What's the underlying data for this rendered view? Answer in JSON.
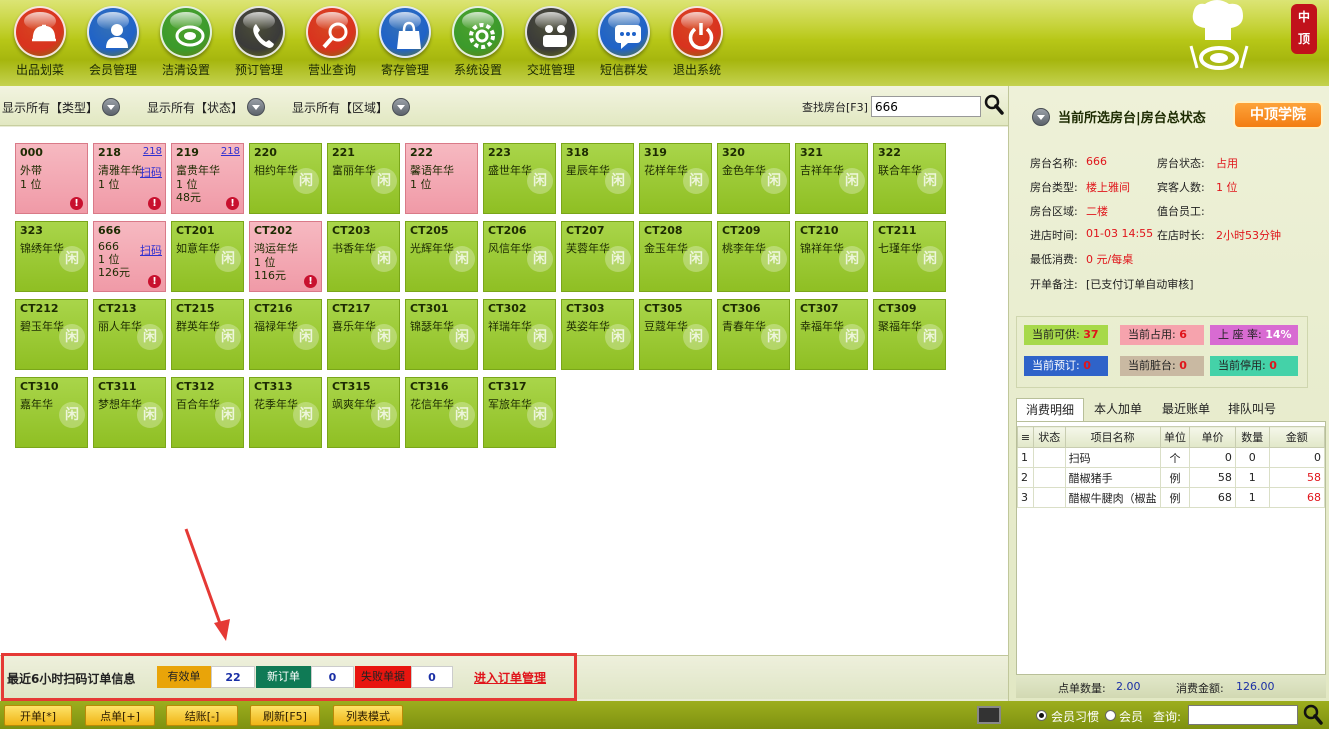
{
  "toolbar": [
    {
      "id": "dish-out",
      "label": "出品划菜",
      "color": "#d9321f",
      "icon": "cloche-icon"
    },
    {
      "id": "member",
      "label": "会员管理",
      "color": "#1f62c9",
      "icon": "person-icon"
    },
    {
      "id": "clean",
      "label": "洁清设置",
      "color": "#3b9a2c",
      "icon": "plate-icon"
    },
    {
      "id": "booking",
      "label": "预订管理",
      "color": "#3a3a3a",
      "icon": "phone-icon"
    },
    {
      "id": "business",
      "label": "营业查询",
      "color": "#d9321f",
      "icon": "magnifier-icon"
    },
    {
      "id": "storage",
      "label": "寄存管理",
      "color": "#1f62c9",
      "icon": "bag-icon"
    },
    {
      "id": "settings",
      "label": "系统设置",
      "color": "#3b9a2c",
      "icon": "gear-icon"
    },
    {
      "id": "shift",
      "label": "交班管理",
      "color": "#3a3a3a",
      "icon": "handover-icon"
    },
    {
      "id": "sms",
      "label": "短信群发",
      "color": "#1f62c9",
      "icon": "chat-icon"
    },
    {
      "id": "exit",
      "label": "退出系统",
      "color": "#d9321f",
      "icon": "power-icon"
    }
  ],
  "brand": {
    "badge": "中顶"
  },
  "filters": {
    "type": "显示所有【类型】",
    "status": "显示所有【状态】",
    "area": "显示所有【区域】",
    "search_label": "查找房台[F3]",
    "search_value": "666"
  },
  "rooms": [
    [
      {
        "num": "000",
        "name": "外带",
        "occ": true,
        "lines": [
          "1 位"
        ],
        "alert": true
      },
      {
        "num": "218",
        "name": "清雅年华",
        "occ": true,
        "tag": "218",
        "scan": "扫码",
        "lines": [
          "1 位"
        ],
        "alert": true
      },
      {
        "num": "219",
        "name": "富贵年华",
        "occ": true,
        "tag": "218",
        "lines": [
          "1 位",
          "48元"
        ],
        "alert": true
      },
      {
        "num": "220",
        "name": "相约年华"
      },
      {
        "num": "221",
        "name": "富丽年华"
      },
      {
        "num": "222",
        "name": "馨语年华",
        "occ": true,
        "lines": [
          "1 位"
        ]
      },
      {
        "num": "223",
        "name": "盛世年华"
      },
      {
        "num": "318",
        "name": "星辰年华"
      },
      {
        "num": "319",
        "name": "花样年华"
      },
      {
        "num": "320",
        "name": "金色年华"
      },
      {
        "num": "321",
        "name": "吉祥年华"
      },
      {
        "num": "322",
        "name": "联合年华"
      }
    ],
    [
      {
        "num": "323",
        "name": "锦绣年华"
      },
      {
        "num": "666",
        "name": "666",
        "occ": true,
        "scan": "扫码",
        "lines": [
          "1 位",
          "126元"
        ],
        "alert": true
      },
      {
        "num": "CT201",
        "name": "如意年华"
      },
      {
        "num": "CT202",
        "name": "鸿运年华",
        "occ": true,
        "lines": [
          "1 位",
          "116元"
        ],
        "alert": true
      },
      {
        "num": "CT203",
        "name": "书香年华"
      },
      {
        "num": "CT205",
        "name": "光辉年华"
      },
      {
        "num": "CT206",
        "name": "风信年华"
      },
      {
        "num": "CT207",
        "name": "芙蓉年华"
      },
      {
        "num": "CT208",
        "name": "金玉年华"
      },
      {
        "num": "CT209",
        "name": "桃李年华"
      },
      {
        "num": "CT210",
        "name": "锦祥年华"
      },
      {
        "num": "CT211",
        "name": "七瑾年华"
      }
    ],
    [
      {
        "num": "CT212",
        "name": "碧玉年华"
      },
      {
        "num": "CT213",
        "name": "丽人年华"
      },
      {
        "num": "CT215",
        "name": "群英年华"
      },
      {
        "num": "CT216",
        "name": "福禄年华"
      },
      {
        "num": "CT217",
        "name": "喜乐年华"
      },
      {
        "num": "CT301",
        "name": "锦瑟年华"
      },
      {
        "num": "CT302",
        "name": "祥瑞年华"
      },
      {
        "num": "CT303",
        "name": "英姿年华"
      },
      {
        "num": "CT305",
        "name": "豆蔻年华"
      },
      {
        "num": "CT306",
        "name": "青春年华"
      },
      {
        "num": "CT307",
        "name": "幸福年华"
      },
      {
        "num": "CT309",
        "name": "聚福年华"
      }
    ],
    [
      {
        "num": "CT310",
        "name": "嘉年华"
      },
      {
        "num": "CT311",
        "name": "梦想年华"
      },
      {
        "num": "CT312",
        "name": "百合年华"
      },
      {
        "num": "CT313",
        "name": "花季年华"
      },
      {
        "num": "CT315",
        "name": "飒爽年华"
      },
      {
        "num": "CT316",
        "name": "花信年华"
      },
      {
        "num": "CT317",
        "name": "军旅年华"
      }
    ]
  ],
  "room_watermark": "闲",
  "scan_info": {
    "title": "最近6小时扫码订单信息",
    "valid_label": "有效单",
    "valid_count": "22",
    "new_label": "新订单",
    "new_count": "0",
    "fail_label": "失败单据",
    "fail_count": "0",
    "link": "进入订单管理"
  },
  "bottom_buttons": [
    "开单[*]",
    "点单[+]",
    "结账[-]",
    "刷新[F5]",
    "列表模式"
  ],
  "right_panel": {
    "title": "当前所选房台|房台总状态",
    "academy": "中顶学院",
    "info": {
      "name_k": "房台名称:",
      "name_v": "666",
      "state_k": "房台状态:",
      "state_v": "占用",
      "type_k": "房台类型:",
      "type_v": "楼上雅间",
      "guests_k": "宾客人数:",
      "guests_v": "1 位",
      "area_k": "房台区域:",
      "area_v": "二楼",
      "staff_k": "值台员工:",
      "staff_v": "",
      "checkin_k": "进店时间:",
      "checkin_v": "01-03 14:55",
      "duration_k": "在店时长:",
      "duration_v": "2小时53分钟",
      "min_k": "最低消费:",
      "min_v": "0 元/每桌",
      "note_k": "开单备注:",
      "note_v": "[已支付订单自动审核]"
    },
    "stats": {
      "available_label": "当前可供:",
      "available": "37",
      "occupied_label": "当前占用:",
      "occupied": "6",
      "rate_label": "上 座 率:",
      "rate": "14%",
      "reserved_label": "当前预订:",
      "reserved": "0",
      "dirty_label": "当前脏台:",
      "dirty": "0",
      "disabled_label": "当前停用:",
      "disabled": "0"
    },
    "tabs": [
      "消费明细",
      "本人加单",
      "最近账单",
      "排队叫号"
    ],
    "table": {
      "headers": [
        "≡",
        "状态",
        "项目名称",
        "单位",
        "单价",
        "数量",
        "金额"
      ],
      "rows": [
        [
          "1",
          "",
          "扫码",
          "个",
          "0",
          "0",
          "0"
        ],
        [
          "2",
          "",
          "醋椒猪手",
          "例",
          "58",
          "1",
          "58"
        ],
        [
          "3",
          "",
          "醋椒牛腱肉（椒盐",
          "例",
          "68",
          "1",
          "68"
        ]
      ]
    },
    "totals": {
      "count_label": "点单数量:",
      "count": "2.00",
      "amount_label": "消费金额:",
      "amount": "126.00"
    },
    "member_habit": "会员习惯",
    "member": "会员",
    "query": "查询:"
  }
}
